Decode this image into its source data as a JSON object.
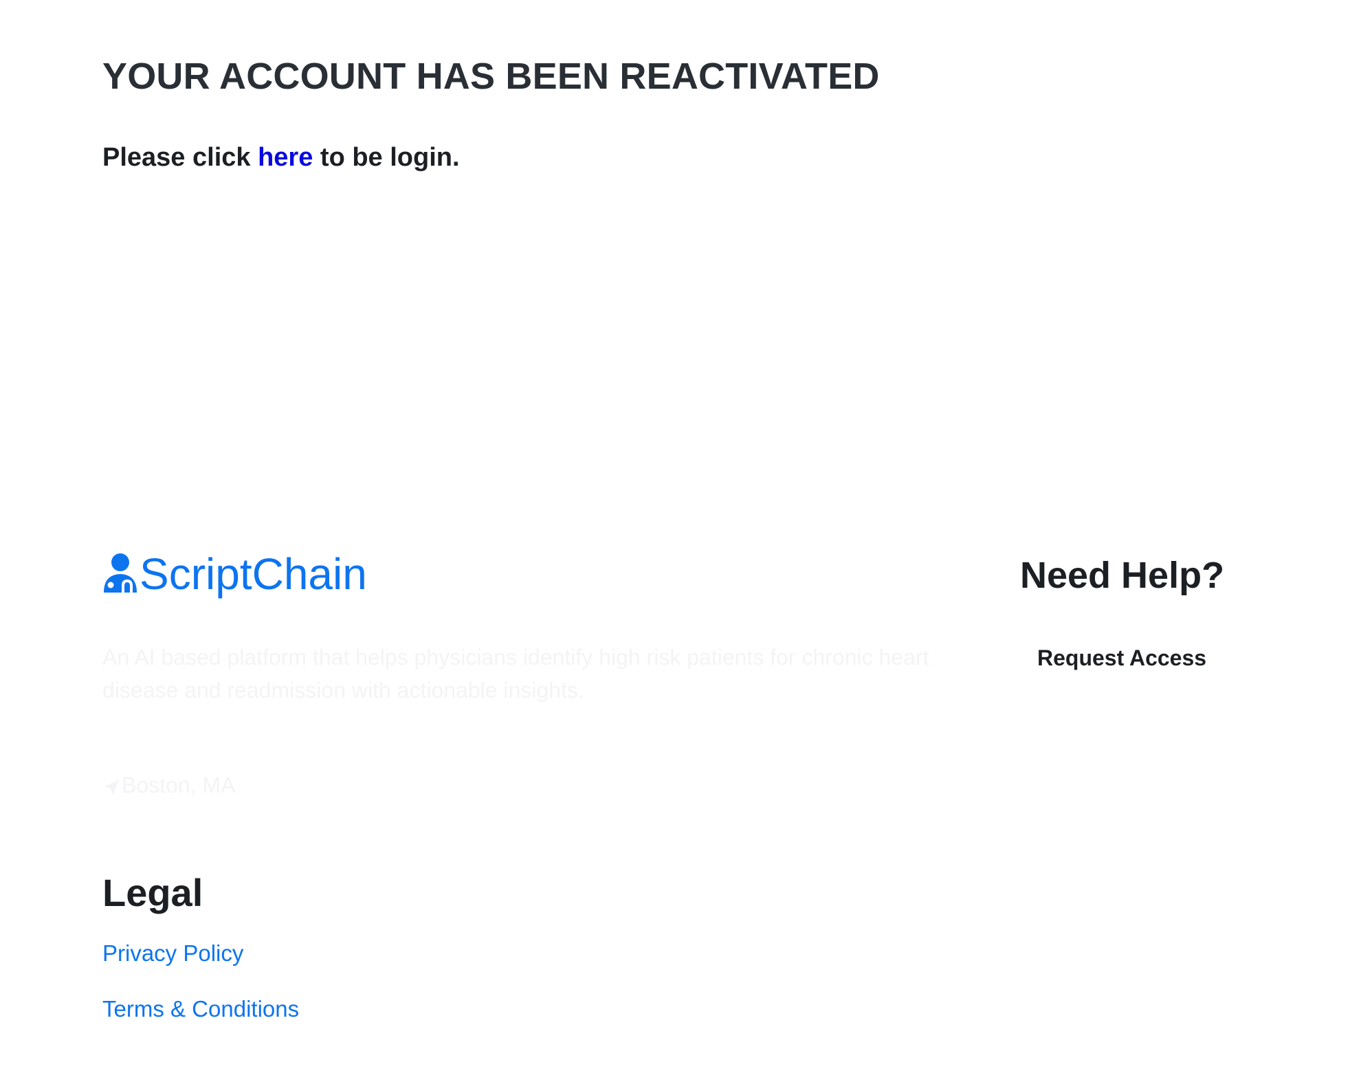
{
  "main": {
    "title": "YOUR ACCOUNT HAS BEEN REACTIVATED",
    "instruction_before": "Please click ",
    "instruction_link": "here",
    "instruction_after": " to be login."
  },
  "footer": {
    "brand": {
      "name": "ScriptChain",
      "icon": "doctor-icon",
      "color": "#0d74f0"
    },
    "tagline": "An AI based platform that helps physicians identify high risk patients for chronic heart disease and readmission with actionable insights.",
    "location": {
      "icon": "location-arrow-icon",
      "text": "Boston, MA"
    },
    "help": {
      "title": "Need Help?",
      "link": "Request Access"
    },
    "legal": {
      "title": "Legal",
      "links": [
        "Privacy Policy",
        "Terms & Conditions"
      ]
    }
  },
  "colors": {
    "link_primary": "#0a0adf",
    "link_footer": "#0d74f0",
    "text_dark": "#1c1f23"
  }
}
